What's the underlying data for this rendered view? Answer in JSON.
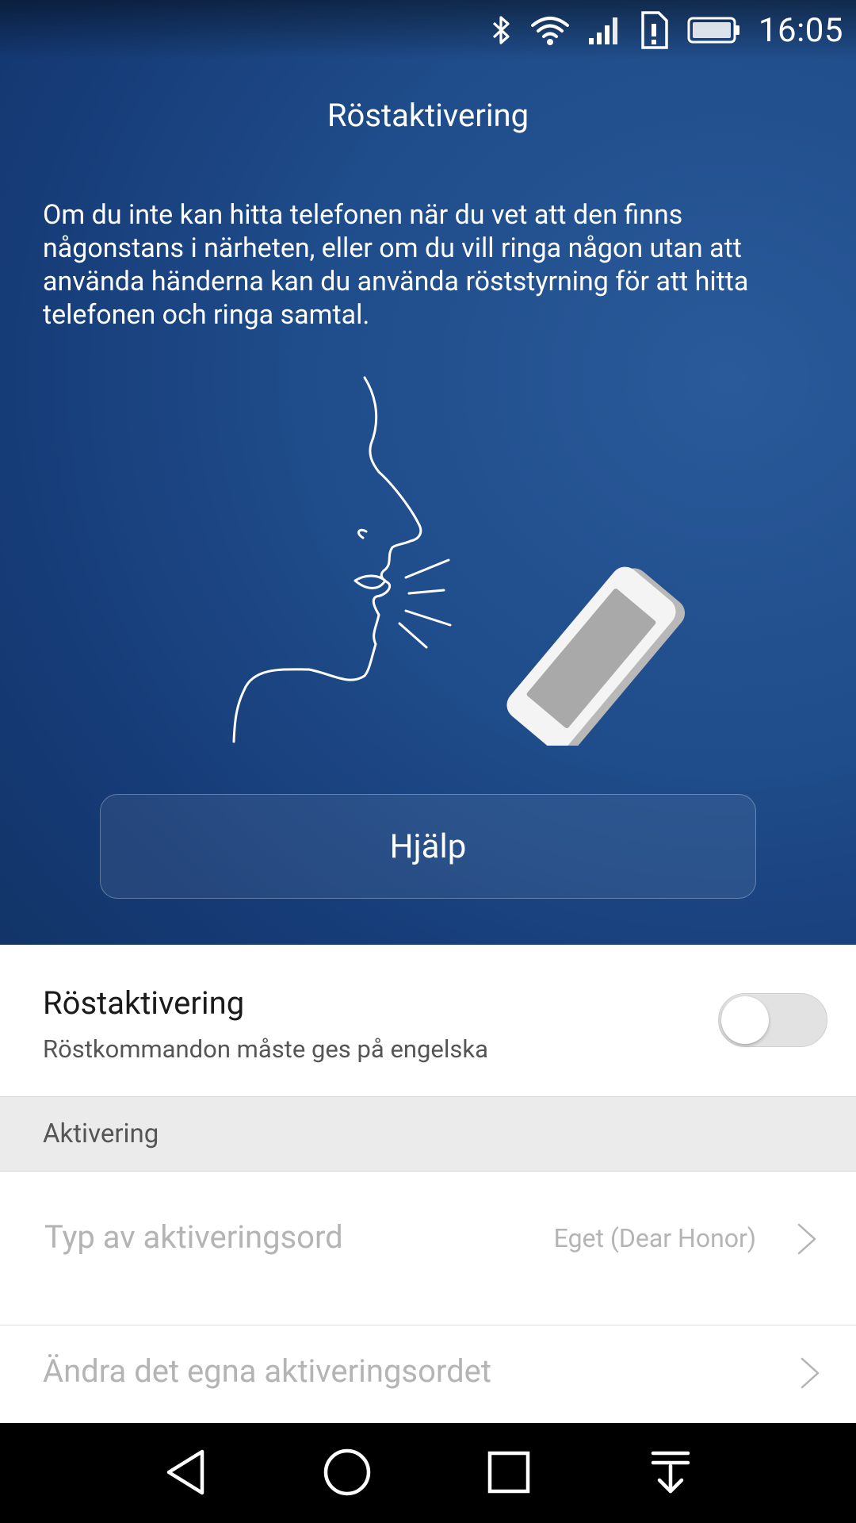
{
  "status_bar": {
    "time": "16:05",
    "icons": [
      "bluetooth-icon",
      "wifi-icon",
      "cell-signal-icon",
      "sim-alert-icon",
      "battery-icon"
    ]
  },
  "header": {
    "title": "Röstaktivering",
    "description": "Om du inte kan hitta telefonen när du vet att den finns någonstans i närheten, eller om du vill ringa någon utan att använda händerna kan du använda röststyrning för att hitta telefonen och ringa samtal.",
    "help_button": "Hjälp"
  },
  "settings": {
    "voice_activation": {
      "title": "Röstaktivering",
      "subtitle": "Röstkommandon måste ges på engelska",
      "enabled": false
    },
    "section_header": "Aktivering",
    "items": [
      {
        "label": "Typ av aktiveringsord",
        "value": "Eget (Dear Honor)",
        "enabled": false
      },
      {
        "label": "Ändra det egna aktiveringsordet",
        "value": "",
        "enabled": false
      }
    ]
  },
  "nav_bar": {
    "buttons": [
      "back-icon",
      "home-icon",
      "recents-icon",
      "notification-pull-icon"
    ]
  },
  "colors": {
    "hero_bg": "#1f4c8a",
    "text_on_hero": "#ffffff",
    "disabled_text": "#b4b4b4",
    "section_bg": "#ebebeb"
  }
}
